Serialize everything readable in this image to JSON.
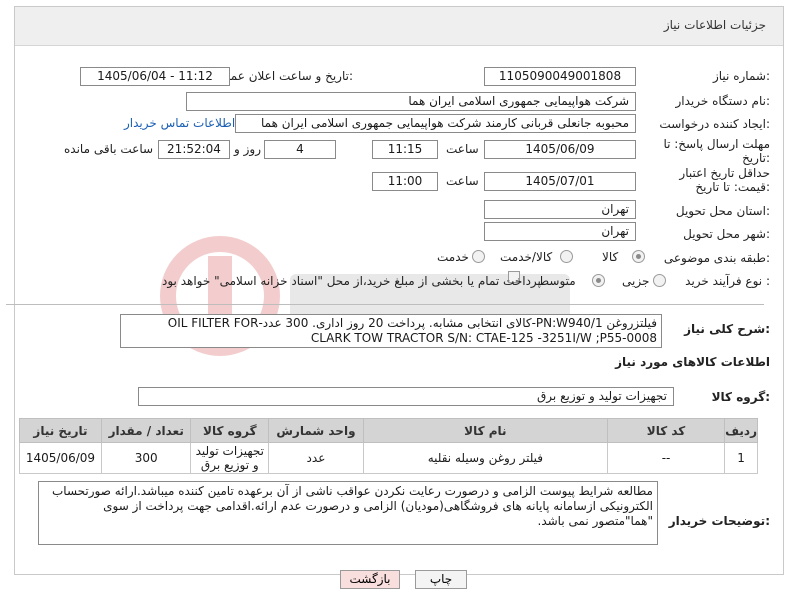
{
  "header": {
    "title": "جزئیات اطلاعات نیاز"
  },
  "fields": {
    "need_number": {
      "label": "شماره نیاز:",
      "value": "1105090049001808"
    },
    "announce_datetime": {
      "label": "تاریخ و ساعت اعلان عمومی:",
      "value": "1405/06/04 - 11:12"
    },
    "buyer_org": {
      "label": "نام دستگاه خریدار:",
      "value": "شرکت هواپیمایی جمهوری اسلامی ایران هما"
    },
    "requester": {
      "label": "ایجاد کننده درخواست:",
      "value": "محبوبه جانعلی قربانی کارمند شرکت هواپیمایی جمهوری اسلامی ایران هما",
      "contact_link": "اطلاعات تماس خریدار"
    },
    "reply_deadline": {
      "label": "مهلت ارسال پاسخ: تا تاریخ:",
      "date": "1405/06/09",
      "time_label": "ساعت",
      "time": "11:15",
      "days": "4",
      "days_label": "روز و",
      "remaining": "21:52:04",
      "remaining_label": "ساعت باقی مانده"
    },
    "price_validity": {
      "label": "حداقل تاریخ اعتبار قیمت: تا تاریخ:",
      "date": "1405/07/01",
      "time_label": "ساعت",
      "time": "11:00"
    },
    "delivery_province": {
      "label": "استان محل تحویل:",
      "value": "تهران"
    },
    "delivery_city": {
      "label": "شهر محل تحویل:",
      "value": "تهران"
    },
    "category": {
      "label": "طبقه بندی موضوعی:",
      "options": [
        "کالا",
        "کالا/خدمت",
        "خدمت"
      ]
    },
    "purchase_type": {
      "label": "نوع فرآیند خرید :",
      "options": [
        "جزیی",
        "متوسط"
      ],
      "note": "پرداخت تمام یا بخشی از مبلغ خرید،از محل \"اسناد خزانه اسلامی\" خواهد بود."
    }
  },
  "summary": {
    "label": "شرح کلی نیاز:",
    "value": "فیلتزروغن PN:W940/1-کالای انتخابی مشابه. پرداخت 20 روز اداری. 300 عدد-OIL FILTER FOR CLARK TOW TRACTOR S/N: CTAE-125 -3251I/W ;P55-0008"
  },
  "goods_section": {
    "title": "اطلاعات کالاهای مورد نیاز",
    "group_label": "گروه کالا:",
    "group_value": "تجهیزات تولید و توزیع برق"
  },
  "table": {
    "headers": [
      "ردیف",
      "کد کالا",
      "نام کالا",
      "واحد شمارش",
      "گروه کالا",
      "تعداد / مقدار",
      "تاریخ نیاز"
    ],
    "rows": [
      [
        "1",
        "--",
        "فیلتر روغن وسیله نقلیه",
        "عدد",
        "تجهیزات تولید و توزیع برق",
        "300",
        "1405/06/09"
      ]
    ]
  },
  "buyer_notes": {
    "label": "توضیحات خریدار:",
    "value": "مطالعه شرایط پیوست الزامی و درصورت رعایت نکردن عواقب ناشی از آن برعهده تامین کننده میباشد.ارائه صورتحساب الکترونیکی ازسامانه پایانه های فروشگاهی(مودیان) الزامی و درصورت عدم ارائه.اقدامی جهت پرداخت از سوی \"هما\"متصور نمی باشد."
  },
  "buttons": {
    "print": "چاپ",
    "back": "بازگشت"
  },
  "colors": {
    "header_bg": "#efefef",
    "link": "#1a5fb4",
    "table_header": "#d4d4d4",
    "back_button": "#f9dede"
  }
}
